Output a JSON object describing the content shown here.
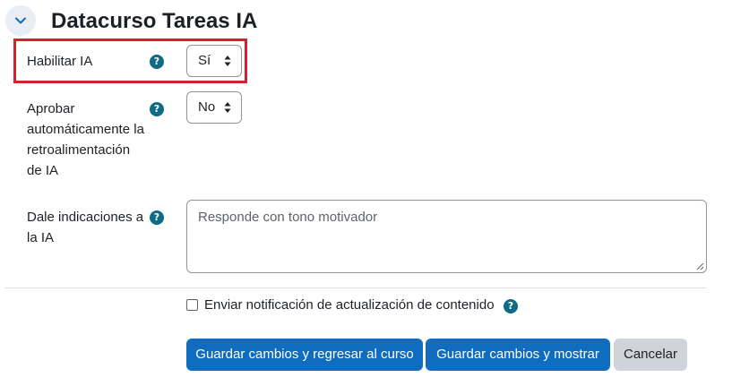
{
  "section": {
    "title": "Datacurso Tareas IA",
    "collapse_icon": "chevron-down-icon",
    "accent_color": "#0f6cbf"
  },
  "fields": {
    "enable_ai": {
      "label": "Habilitar IA",
      "value": "Sí",
      "help_icon": "question-circle-icon"
    },
    "auto_approve": {
      "label_lines": [
        "Aprobar",
        "automáticamente la",
        "retroalimentación",
        "de IA"
      ],
      "value": "No",
      "help_icon": "question-circle-icon"
    },
    "instructions": {
      "label_lines": [
        "Dale indicaciones a",
        "la IA"
      ],
      "value": "Responde con tono motivador",
      "help_icon": "question-circle-icon"
    }
  },
  "notification": {
    "label": "Enviar notificación de actualización de contenido",
    "checked": false
  },
  "buttons": {
    "save_return": "Guardar cambios y regresar al curso",
    "save_show": "Guardar cambios y mostrar",
    "cancel": "Cancelar"
  },
  "highlight_color": "#d9202a"
}
